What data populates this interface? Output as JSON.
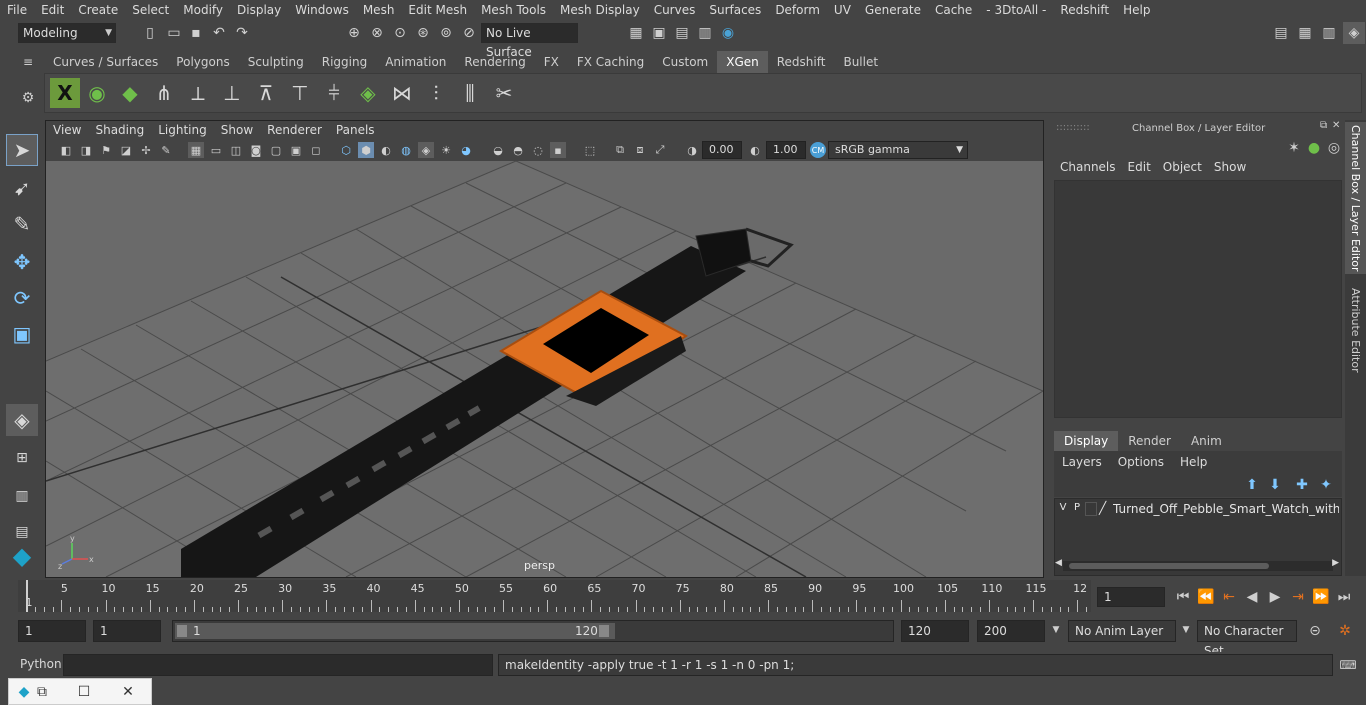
{
  "menubar": [
    "File",
    "Edit",
    "Create",
    "Select",
    "Modify",
    "Display",
    "Windows",
    "Mesh",
    "Edit Mesh",
    "Mesh Tools",
    "Mesh Display",
    "Curves",
    "Surfaces",
    "Deform",
    "UV",
    "Generate",
    "Cache",
    "- 3DtoAll -",
    "Redshift",
    "Help"
  ],
  "status": {
    "workspace": "Modeling",
    "live_surface": "No Live Surface"
  },
  "shelf": {
    "tabs": [
      "Curves / Surfaces",
      "Polygons",
      "Sculpting",
      "Rigging",
      "Animation",
      "Rendering",
      "FX",
      "FX Caching",
      "Custom",
      "XGen",
      "Redshift",
      "Bullet"
    ],
    "active_tab": "XGen"
  },
  "viewport": {
    "menu": [
      "View",
      "Shading",
      "Lighting",
      "Show",
      "Renderer",
      "Panels"
    ],
    "exposure": "0.00",
    "gamma": "1.00",
    "colorspace": "sRGB gamma",
    "camera_label": "persp"
  },
  "channelbox": {
    "title": "Channel Box / Layer Editor",
    "menu": [
      "Channels",
      "Edit",
      "Object",
      "Show"
    ],
    "tabs": [
      "Display",
      "Render",
      "Anim"
    ],
    "active_tab": "Display",
    "layer_menu": [
      "Layers",
      "Options",
      "Help"
    ],
    "layer": {
      "v": "V",
      "p": "P",
      "name": "Turned_Off_Pebble_Smart_Watch_with_Strap"
    }
  },
  "side_tabs": [
    "Channel Box / Layer Editor",
    "Attribute Editor"
  ],
  "timeline": {
    "ticks": [
      "1",
      "5",
      "10",
      "15",
      "20",
      "25",
      "30",
      "35",
      "40",
      "45",
      "50",
      "55",
      "60",
      "65",
      "70",
      "75",
      "80",
      "85",
      "90",
      "95",
      "100",
      "105",
      "110",
      "115",
      "12"
    ],
    "current_frame": "1"
  },
  "range": {
    "start": "1",
    "playback_start": "1",
    "slider_start": "1",
    "slider_end": "120",
    "playback_end": "120",
    "end": "200",
    "anim_layer": "No Anim Layer",
    "character_set": "No Character Set"
  },
  "command": {
    "language": "Python",
    "result": "makeIdentity -apply true -t 1 -r 1 -s 1 -n 0 -pn 1;"
  },
  "colors": {
    "accent": "#5285a6",
    "watch_orange": "#e07020",
    "grid_bg": "#6a6a6a"
  }
}
